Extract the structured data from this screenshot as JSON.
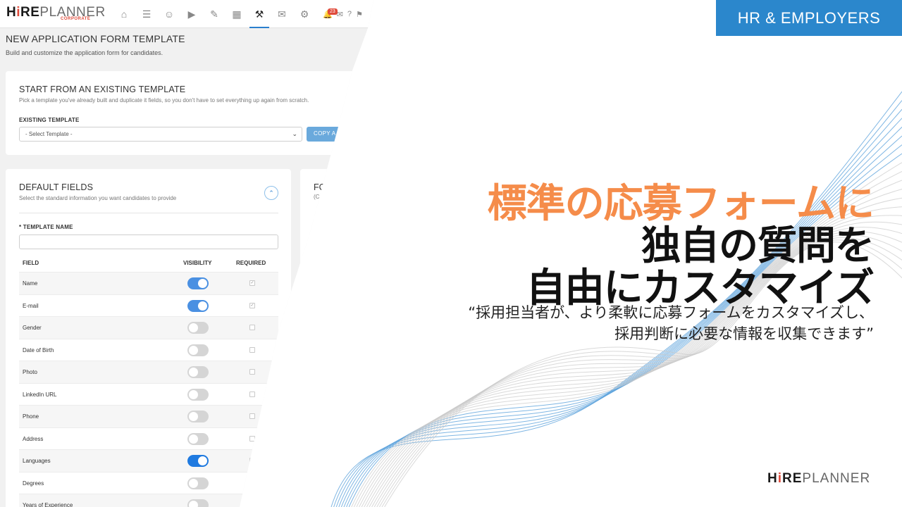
{
  "app": {
    "logo": {
      "hire_h": "H",
      "hire_i": "i",
      "hire_re": "RE",
      "planner": "PLANNER",
      "sub": "CORPORATE"
    },
    "nav_icons": [
      "home-icon",
      "document-icon",
      "users-icon",
      "megaphone-icon",
      "edit-icon",
      "calendar-icon",
      "wrench-icon",
      "mail-icon",
      "gear-icon"
    ],
    "active_nav": "wrench-icon",
    "notification_count": "23",
    "page_title": "NEW APPLICATION FORM TEMPLATE",
    "page_subtitle": "Build and customize the application form for candidates.",
    "existing": {
      "title": "START FROM AN EXISTING TEMPLATE",
      "subtitle": "Pick a template you've already built and duplicate it fields, so you don't have to set everything up again from scratch.",
      "label": "EXISTING TEMPLATE",
      "select_value": "- Select Template -",
      "copy_button": "COPY A"
    },
    "default_fields": {
      "title": "DEFAULT FIELDS",
      "subtitle": "Select the standard information you want candidates to provide",
      "template_name_label": "* TEMPLATE NAME",
      "headers": {
        "field": "FIELD",
        "visibility": "VISIBILITY",
        "required": "REQUIRED"
      },
      "rows": [
        {
          "name": "Name",
          "visible": true,
          "required": true
        },
        {
          "name": "E-mail",
          "visible": true,
          "required": true
        },
        {
          "name": "Gender",
          "visible": false,
          "required": false
        },
        {
          "name": "Date of Birth",
          "visible": false,
          "required": false
        },
        {
          "name": "Photo",
          "visible": false,
          "required": false
        },
        {
          "name": "LinkedIn URL",
          "visible": false,
          "required": false
        },
        {
          "name": "Phone",
          "visible": false,
          "required": false
        },
        {
          "name": "Address",
          "visible": false,
          "required": false
        },
        {
          "name": "Languages",
          "visible": true,
          "required": false
        },
        {
          "name": "Degrees",
          "visible": false,
          "required": false
        },
        {
          "name": "Years of Experience",
          "visible": false,
          "required": false
        }
      ]
    },
    "custom": {
      "title": "FO",
      "subtitle": "(C"
    }
  },
  "badge": "HR & EMPLOYERS",
  "headline": {
    "line1": "標準の応募フォームに",
    "line2": "独自の質問を",
    "line3": "自由にカスタマイズ"
  },
  "quote": {
    "line1": "“採用担当者が、より柔軟に応募フォームをカスタマイズし、",
    "line2": "採用判断に必要な情報を収集できます”"
  },
  "brand": {
    "hire_h": "H",
    "hire_i": "i",
    "hire_re": "RE",
    "planner": "PLANNER"
  },
  "colors": {
    "accent_blue": "#2b87cc",
    "headline_orange": "#f58c4a",
    "toggle_on": "#4a90e2",
    "brand_red": "#e04a3a"
  }
}
